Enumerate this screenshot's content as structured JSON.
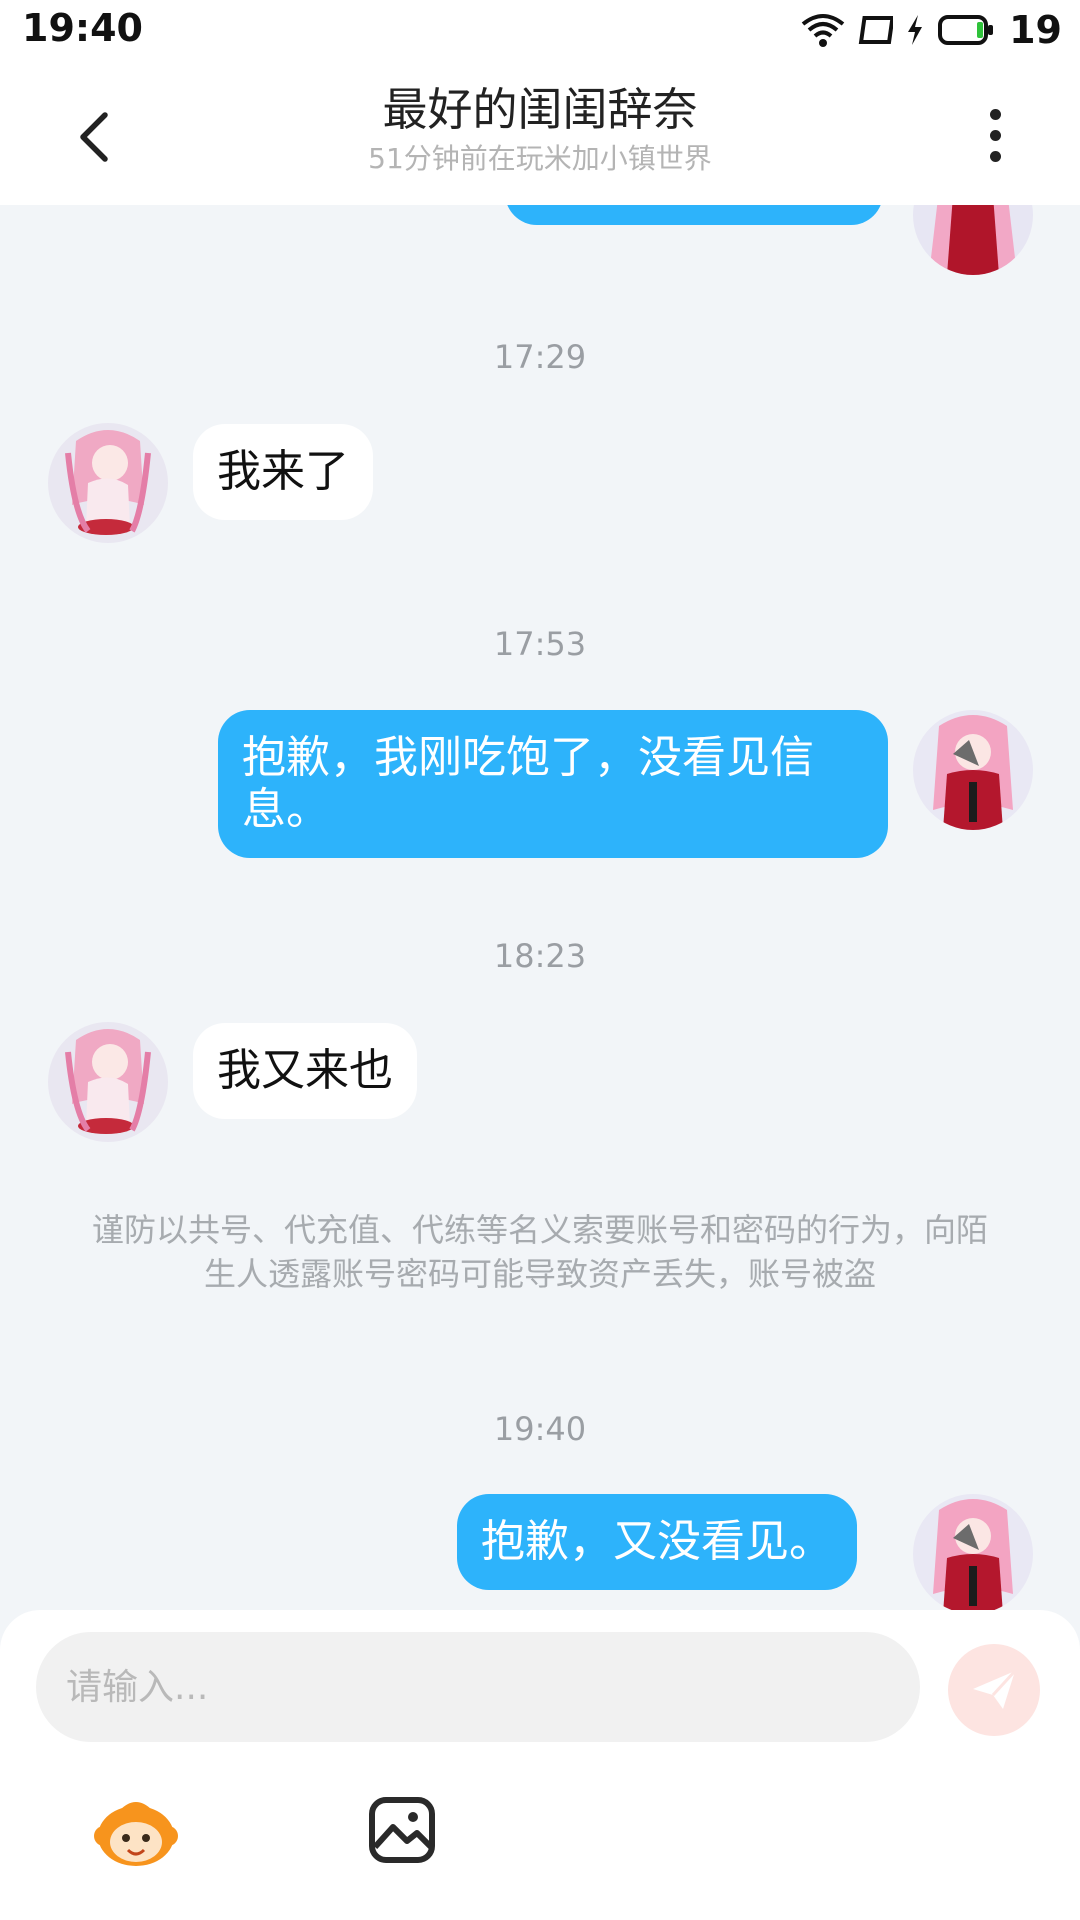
{
  "status_bar": {
    "time": "19:40",
    "battery": "19",
    "icons": [
      "wifi-icon",
      "screen-icon",
      "charging-icon",
      "battery-icon"
    ]
  },
  "header": {
    "title": "最好的闺闺辞奈",
    "subtitle": "51分钟前在玩米加小镇世界",
    "back_icon": "chevron-left-icon",
    "more_icon": "more-vertical-icon"
  },
  "messages": [
    {
      "type": "timestamp",
      "text": "17:29"
    },
    {
      "type": "incoming",
      "text": "我来了"
    },
    {
      "type": "timestamp",
      "text": "17:53"
    },
    {
      "type": "outgoing",
      "text": "抱歉，我刚吃饱了，没看见信息。"
    },
    {
      "type": "timestamp",
      "text": "18:23"
    },
    {
      "type": "incoming",
      "text": "我又来也"
    },
    {
      "type": "notice",
      "text": "谨防以共号、代充值、代练等名义索要账号和密码的行为，向陌生人透露账号密码可能导致资产丢失，账号被盗"
    },
    {
      "type": "timestamp",
      "text": "19:40"
    },
    {
      "type": "outgoing",
      "text": "抱歉，又没看见。"
    }
  ],
  "composer": {
    "placeholder": "请输入...",
    "value": "",
    "send_icon": "send-icon",
    "tools": [
      "emoji-mascot-icon",
      "image-icon"
    ]
  },
  "colors": {
    "outgoing_bubble": "#2db3fb",
    "incoming_bubble": "#ffffff",
    "background": "#f2f5f8",
    "send_button": "#fde4e1"
  }
}
